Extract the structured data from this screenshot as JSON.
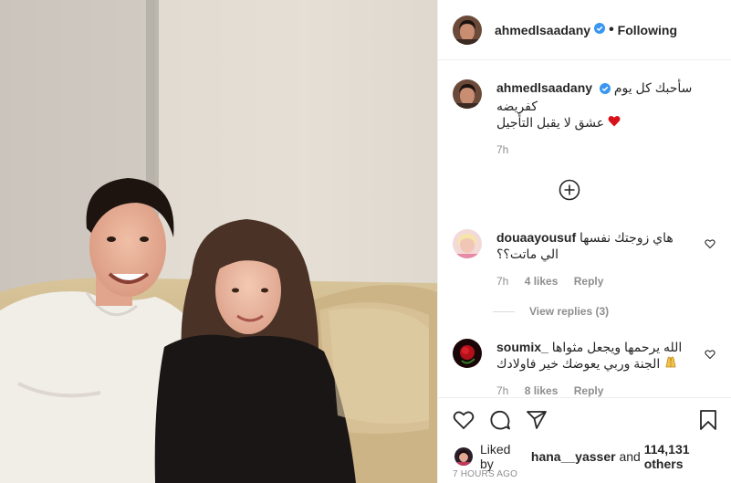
{
  "post": {
    "username": "ahmedlsaadany",
    "separator": "•",
    "follow_status": "Following"
  },
  "caption": {
    "username": "ahmedlsaadany",
    "line1": "سأحبك كل يوم",
    "line2": "كفريضه",
    "line3": "عشق لا يقبل التأجيل",
    "time": "7h"
  },
  "comments": [
    {
      "username": "douaayousuf",
      "line1": "هاي زوجتك نفسها",
      "line2": "الي ماتت؟؟",
      "time": "7h",
      "likes": "4 likes",
      "reply": "Reply",
      "view_replies": "View replies (3)"
    },
    {
      "username": "soumix_",
      "line1": "الله يرحمها ويجعل مثواها",
      "line2": "الجنة وربي يعوضك خير فاولادك",
      "time": "7h",
      "likes": "8 likes",
      "reply": "Reply"
    }
  ],
  "likes": {
    "prefix": "Liked by",
    "user": "hana__yasser",
    "middle": "and",
    "count": "114,131 others"
  },
  "timestamp": "7 HOURS AGO",
  "colors": {
    "verified": "#3897f0",
    "text": "#262626",
    "muted": "#8e8e8e",
    "heart": "#ed4956"
  },
  "icons": [
    "verified-badge-icon",
    "heart-icon",
    "comment-icon",
    "share-icon",
    "bookmark-icon",
    "add-comment-icon",
    "red-heart-emoji"
  ]
}
